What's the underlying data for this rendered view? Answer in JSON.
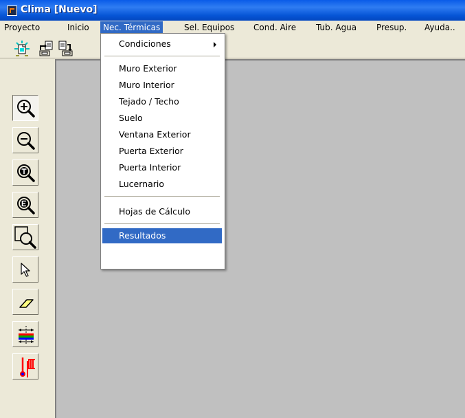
{
  "window": {
    "title": "Clima [Nuevo]"
  },
  "menubar": {
    "items": [
      {
        "label": "Proyecto"
      },
      {
        "label": "Inicio"
      },
      {
        "label": "Nec. Térmicas",
        "active": true
      },
      {
        "label": "Sel. Equipos"
      },
      {
        "label": "Cond. Aire"
      },
      {
        "label": "Tub. Agua"
      },
      {
        "label": "Presup."
      },
      {
        "label": "Ayuda.."
      }
    ]
  },
  "dropdown": {
    "items": [
      {
        "label": "Condiciones",
        "submenu": true
      },
      {
        "label": "Muro Exterior"
      },
      {
        "label": "Muro Interior"
      },
      {
        "label": "Tejado / Techo"
      },
      {
        "label": "Suelo"
      },
      {
        "label": "Ventana Exterior"
      },
      {
        "label": "Puerta Exterior"
      },
      {
        "label": "Puerta Interior"
      },
      {
        "label": "Lucernario"
      },
      {
        "label": "Hojas de Cálculo"
      },
      {
        "label": "Resultados",
        "highlighted": true
      }
    ]
  },
  "toolbar": {
    "icons": [
      "new-project-icon",
      "import-icon",
      "export-icon"
    ]
  },
  "sidebar": {
    "tools": [
      "zoom-in-icon",
      "zoom-out-icon",
      "zoom-total-icon",
      "zoom-extents-icon",
      "zoom-window-icon",
      "pointer-icon",
      "eraser-icon",
      "move-icon",
      "thermal-elements-icon"
    ],
    "selected": "zoom-in-icon"
  },
  "colors": {
    "title_bar": "#0a5ce8",
    "menu_highlight": "#316ac5",
    "canvas": "#c0c0c0",
    "chrome": "#ece9d8"
  }
}
